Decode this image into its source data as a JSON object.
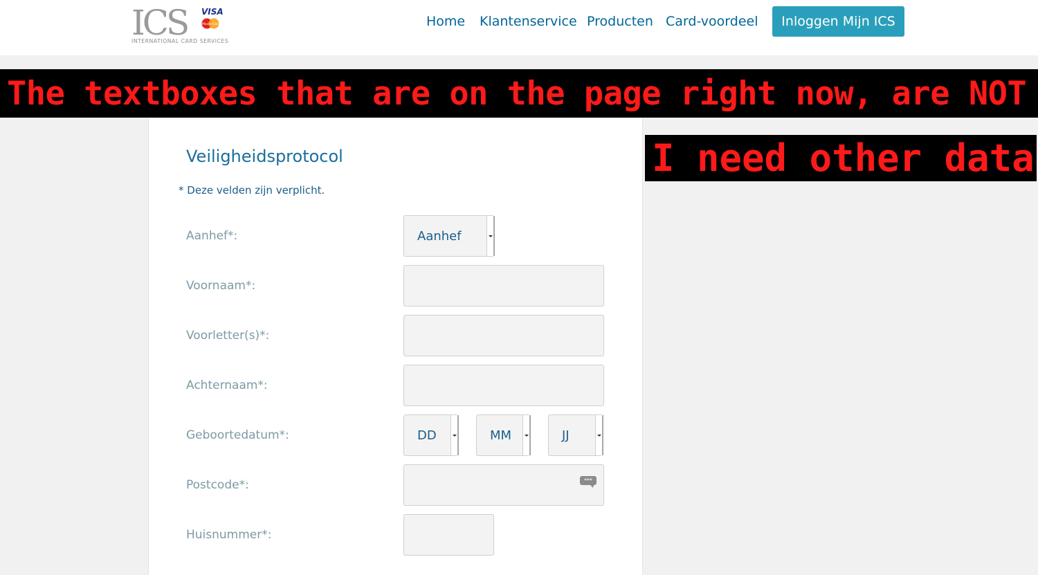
{
  "header": {
    "logo": {
      "letters": "ICS",
      "visa": "VISA",
      "mastercard": "MasterCard",
      "tagline": "INTERNATIONAL CARD SERVICES"
    },
    "nav": [
      "Home",
      "Klantenservice",
      "Producten",
      "Card-voordeel"
    ],
    "login_button": "Inloggen Mijn ICS"
  },
  "banners": {
    "line1": "The textboxes that are on the page right now, are NOT good.",
    "line2": "I need other data."
  },
  "form": {
    "title": "Veiligheidsprotocol",
    "required_note": "* Deze velden zijn verplicht.",
    "labels": {
      "aanhef": "Aanhef*:",
      "voornaam": "Voornaam*:",
      "voorletters": "Voorletter(s)*:",
      "achternaam": "Achternaam*:",
      "geboortedatum": "Geboortedatum*:",
      "postcode": "Postcode*:",
      "huisnummer": "Huisnummer*:"
    },
    "selects": {
      "aanhef": "Aanhef",
      "day": "DD",
      "month": "MM",
      "year": "JJ"
    },
    "postcode_icon": "password-dots-icon"
  },
  "colors": {
    "brand_blue": "#2a9fbc",
    "link_blue": "#006699",
    "banner_red": "#ff1a1a",
    "banner_bg": "#000000"
  }
}
